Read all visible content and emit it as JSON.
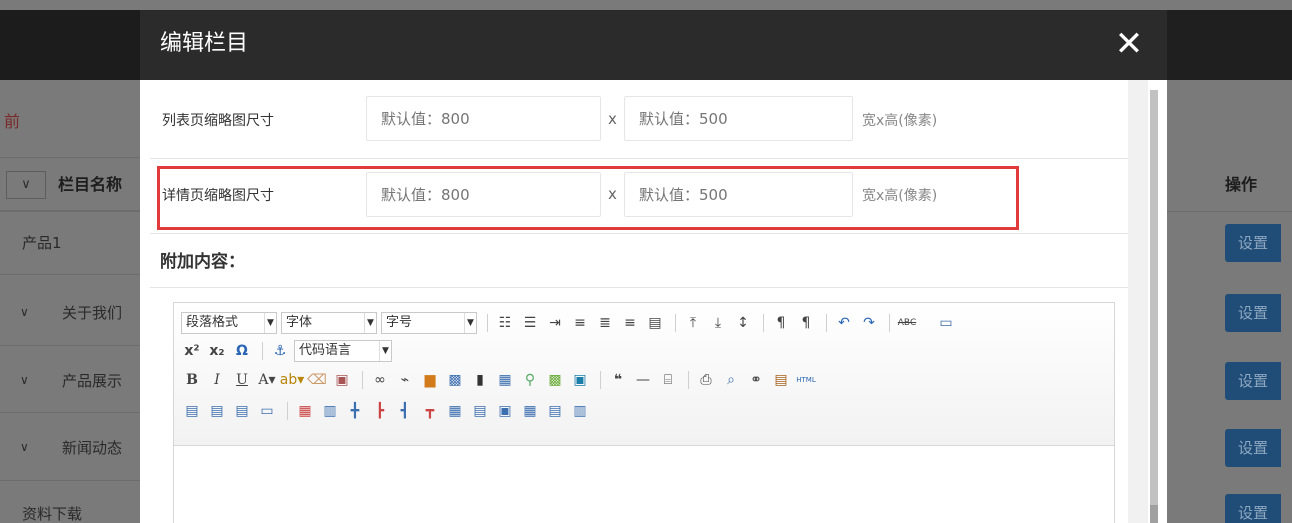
{
  "background": {
    "red_mark": "前",
    "table_header": {
      "check_col": "∨",
      "name_col": "栏目名称",
      "op_col": "操作"
    },
    "rows": [
      {
        "name": "产品1",
        "chevron": ""
      },
      {
        "name": "关于我们",
        "chevron": "∨"
      },
      {
        "name": "产品展示",
        "chevron": "∨"
      },
      {
        "name": "新闻动态",
        "chevron": "∨"
      },
      {
        "name": "资料下载",
        "chevron": ""
      }
    ],
    "button_label": "设置"
  },
  "modal": {
    "title": "编辑栏目",
    "close_symbol": "✕",
    "list_thumb": {
      "label": "列表页缩略图尺寸",
      "width_placeholder": "默认值：800",
      "times": "x",
      "height_placeholder": "默认值：500",
      "unit": "宽x高(像素)"
    },
    "detail_thumb": {
      "label": "详情页缩略图尺寸",
      "width_placeholder": "默认值：800",
      "times": "x",
      "height_placeholder": "默认值：500",
      "unit": "宽x高(像素)"
    },
    "extra_content_label": "附加内容："
  },
  "editor": {
    "combos": {
      "paragraph": "段落格式",
      "font": "字体",
      "size": "字号",
      "code_lang": "代码语言"
    },
    "html_label": "HTML",
    "strikethrough_label": "ABC",
    "icons_row1": [
      "ordered-list-icon",
      "unordered-list-icon",
      "indent-icon",
      "align-left-icon",
      "align-center-icon",
      "align-right-icon",
      "align-justify-icon",
      "paragraph-spacing-top-icon",
      "paragraph-spacing-bottom-icon",
      "line-height-icon",
      "ltr-icon",
      "rtl-icon",
      "undo-icon",
      "redo-icon",
      "strikethrough-icon",
      "fullscreen-icon"
    ],
    "icons_row2": [
      "superscript-icon",
      "subscript-icon",
      "special-char-icon",
      "anchor-icon"
    ],
    "icons_row3": [
      "bold-icon",
      "italic-icon",
      "underline-icon",
      "font-color-icon",
      "highlight-icon",
      "eraser-icon",
      "format-painter-icon",
      "link-icon",
      "unlink-icon",
      "image-icon",
      "word-image-icon",
      "insert-frame-icon",
      "table-icon",
      "attachment-icon",
      "map-icon",
      "gmap-icon",
      "blockquote-icon",
      "horizontal-rule-icon",
      "page-break-icon",
      "print-icon",
      "preview-icon",
      "search-replace-icon",
      "paste-icon",
      "html-icon"
    ],
    "icons_row4": [
      "table-align-left-icon",
      "table-align-center-icon",
      "table-align-right-icon",
      "table-no-wrap-icon",
      "insert-table-icon",
      "insert-title-row-icon",
      "insert-row-icon",
      "insert-col-icon",
      "delete-col-icon",
      "merge-cells-icon",
      "split-cells-icon",
      "merge-right-icon",
      "merge-down-icon",
      "split-rows-icon",
      "split-cols-icon",
      "delete-table-icon"
    ]
  }
}
